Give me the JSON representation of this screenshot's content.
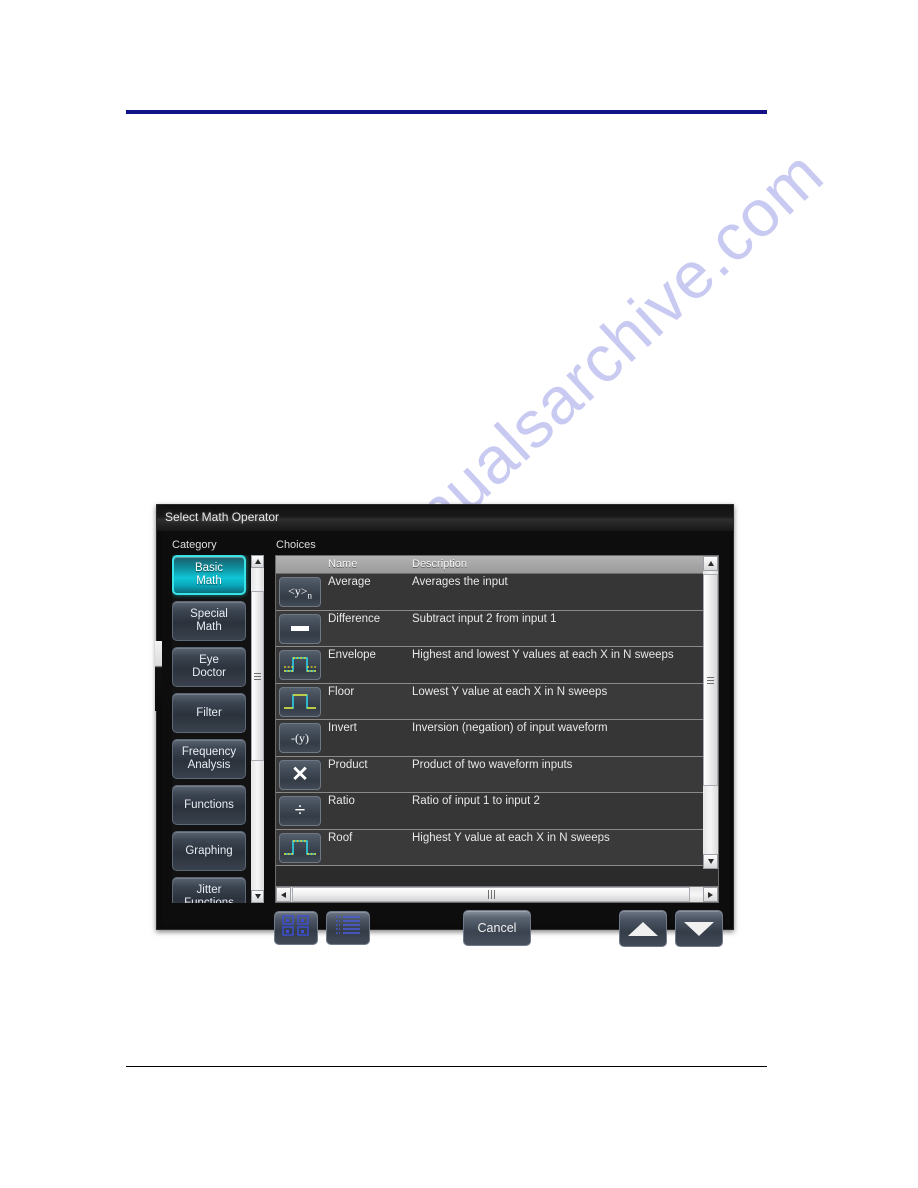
{
  "page": {
    "watermark_text": "manualsarchive.com"
  },
  "dialog": {
    "title": "Select Math Operator",
    "category_label": "Category",
    "choices_label": "Choices"
  },
  "categories": [
    {
      "label": "Basic Math",
      "line1": "Basic",
      "line2": "Math",
      "selected": true
    },
    {
      "label": "Special Math",
      "line1": "Special",
      "line2": "Math",
      "selected": false
    },
    {
      "label": "Eye Doctor",
      "line1": "Eye",
      "line2": "Doctor",
      "selected": false
    },
    {
      "label": "Filter",
      "line1": "Filter",
      "line2": "",
      "selected": false
    },
    {
      "label": "Frequency Analysis",
      "line1": "Frequency",
      "line2": "Analysis",
      "selected": false
    },
    {
      "label": "Functions",
      "line1": "Functions",
      "line2": "",
      "selected": false
    },
    {
      "label": "Graphing",
      "line1": "Graphing",
      "line2": "",
      "selected": false
    },
    {
      "label": "Jitter Functions",
      "line1": "Jitter",
      "line2": "Functions",
      "selected": false
    }
  ],
  "choices": {
    "columns": {
      "name": "Name",
      "description": "Description"
    },
    "rows": [
      {
        "icon": "average-operator-icon",
        "name": "Average",
        "description": "Averages the input"
      },
      {
        "icon": "difference-operator-icon",
        "name": "Difference",
        "description": "Subtract input 2 from input 1"
      },
      {
        "icon": "envelope-operator-icon",
        "name": "Envelope",
        "description": "Highest and lowest Y values at each X in N sweeps"
      },
      {
        "icon": "floor-operator-icon",
        "name": "Floor",
        "description": "Lowest Y value at each X in N sweeps"
      },
      {
        "icon": "invert-operator-icon",
        "name": "Invert",
        "description": "Inversion (negation) of input waveform"
      },
      {
        "icon": "product-operator-icon",
        "name": "Product",
        "description": "Product of two waveform inputs"
      },
      {
        "icon": "ratio-operator-icon",
        "name": "Ratio",
        "description": "Ratio of input 1 to input 2"
      },
      {
        "icon": "roof-operator-icon",
        "name": "Roof",
        "description": "Highest Y value at each X in N sweeps"
      }
    ]
  },
  "toolbar": {
    "icon_view_label": "",
    "list_view_label": "",
    "cancel_label": "Cancel",
    "scroll_up_label": "",
    "scroll_down_label": ""
  },
  "colors": {
    "accent_selected": "#0fc6d6",
    "accent_selected_border": "#38e3e8",
    "page_rule": "#131388",
    "waveform_cyan": "#2ad4e8",
    "waveform_yellow": "#e8e02a",
    "watermark": "#c9caf2"
  }
}
